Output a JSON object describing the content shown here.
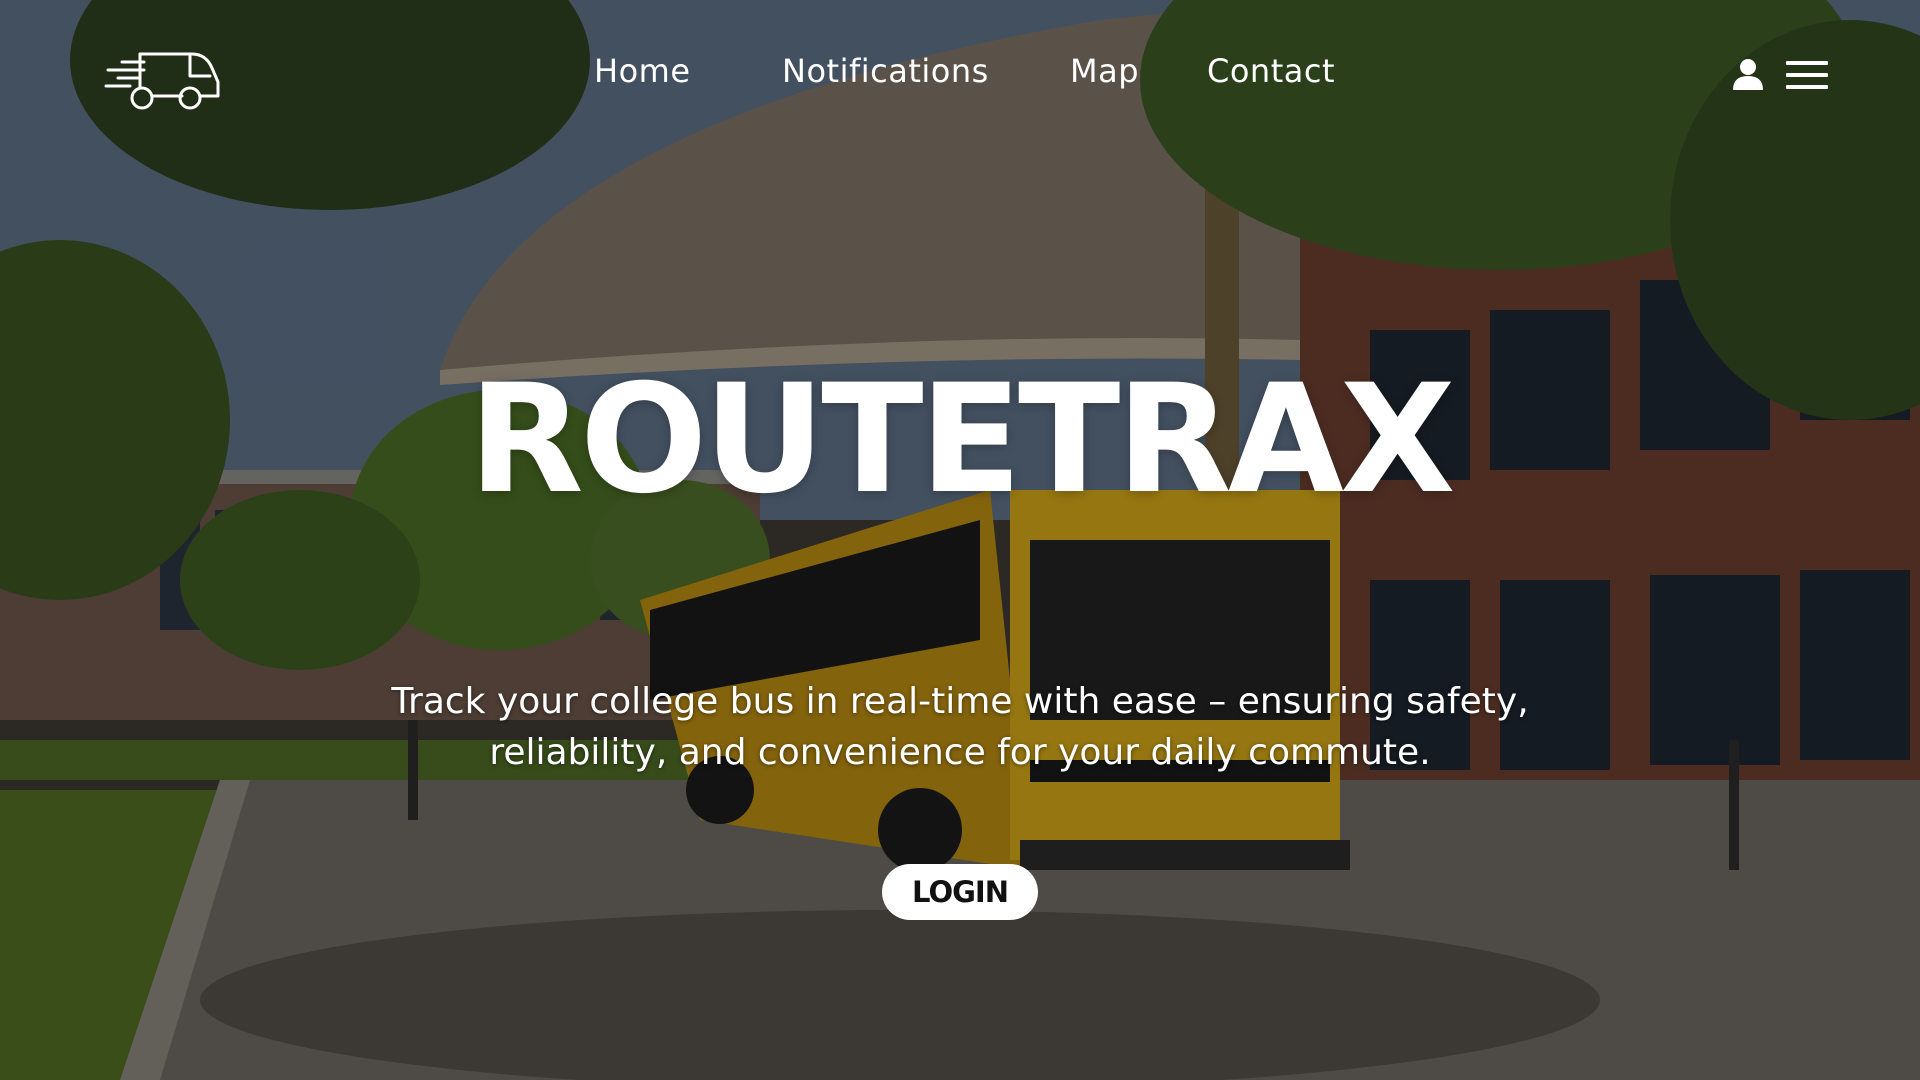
{
  "nav": {
    "items": [
      {
        "label": "Home"
      },
      {
        "label": "Notifications"
      },
      {
        "label": "Map"
      },
      {
        "label": "Contact"
      }
    ]
  },
  "header": {
    "logo_icon": "bus-logo-icon",
    "user_icon": "user-icon",
    "menu_icon": "hamburger-menu-icon"
  },
  "hero": {
    "title": "ROUTETRAX",
    "subtitle_line1": "Track your college bus in real-time with ease – ensuring safety,",
    "subtitle_line2": "reliability, and convenience for your daily commute.",
    "login_label": "LOGIN"
  },
  "colors": {
    "text": "#ffffff",
    "button_bg": "#ffffff",
    "button_text": "#111111",
    "bus_yellow": "#e0b21a"
  }
}
